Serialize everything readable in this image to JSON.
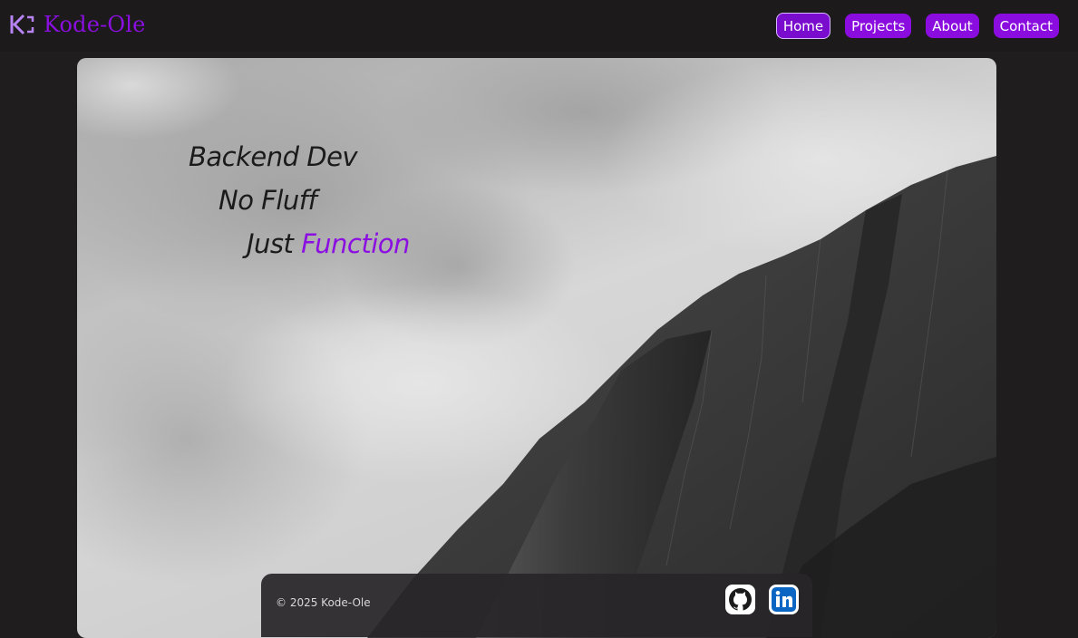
{
  "brand": {
    "name": "Kode-Ole",
    "logo_icon": "kode-bracket-logo-icon"
  },
  "nav": {
    "items": [
      {
        "label": "Home",
        "active": true
      },
      {
        "label": "Projects",
        "active": false
      },
      {
        "label": "About",
        "active": false
      },
      {
        "label": "Contact",
        "active": false
      }
    ]
  },
  "hero": {
    "line1": "Backend Dev",
    "line2": "No Fluff",
    "line3_prefix": "Just",
    "line3_accent": "Function",
    "image": "grayscale mountain cliff under cloudy sky"
  },
  "footer": {
    "copyright": "© 2025 Kode-Ole",
    "social": [
      {
        "name": "github-icon"
      },
      {
        "name": "linkedin-icon"
      }
    ]
  },
  "colors": {
    "accent": "#8a0fe0",
    "button": "#8a0cde",
    "background": "#1f1d1e",
    "text_dark": "#1b1b1b"
  }
}
